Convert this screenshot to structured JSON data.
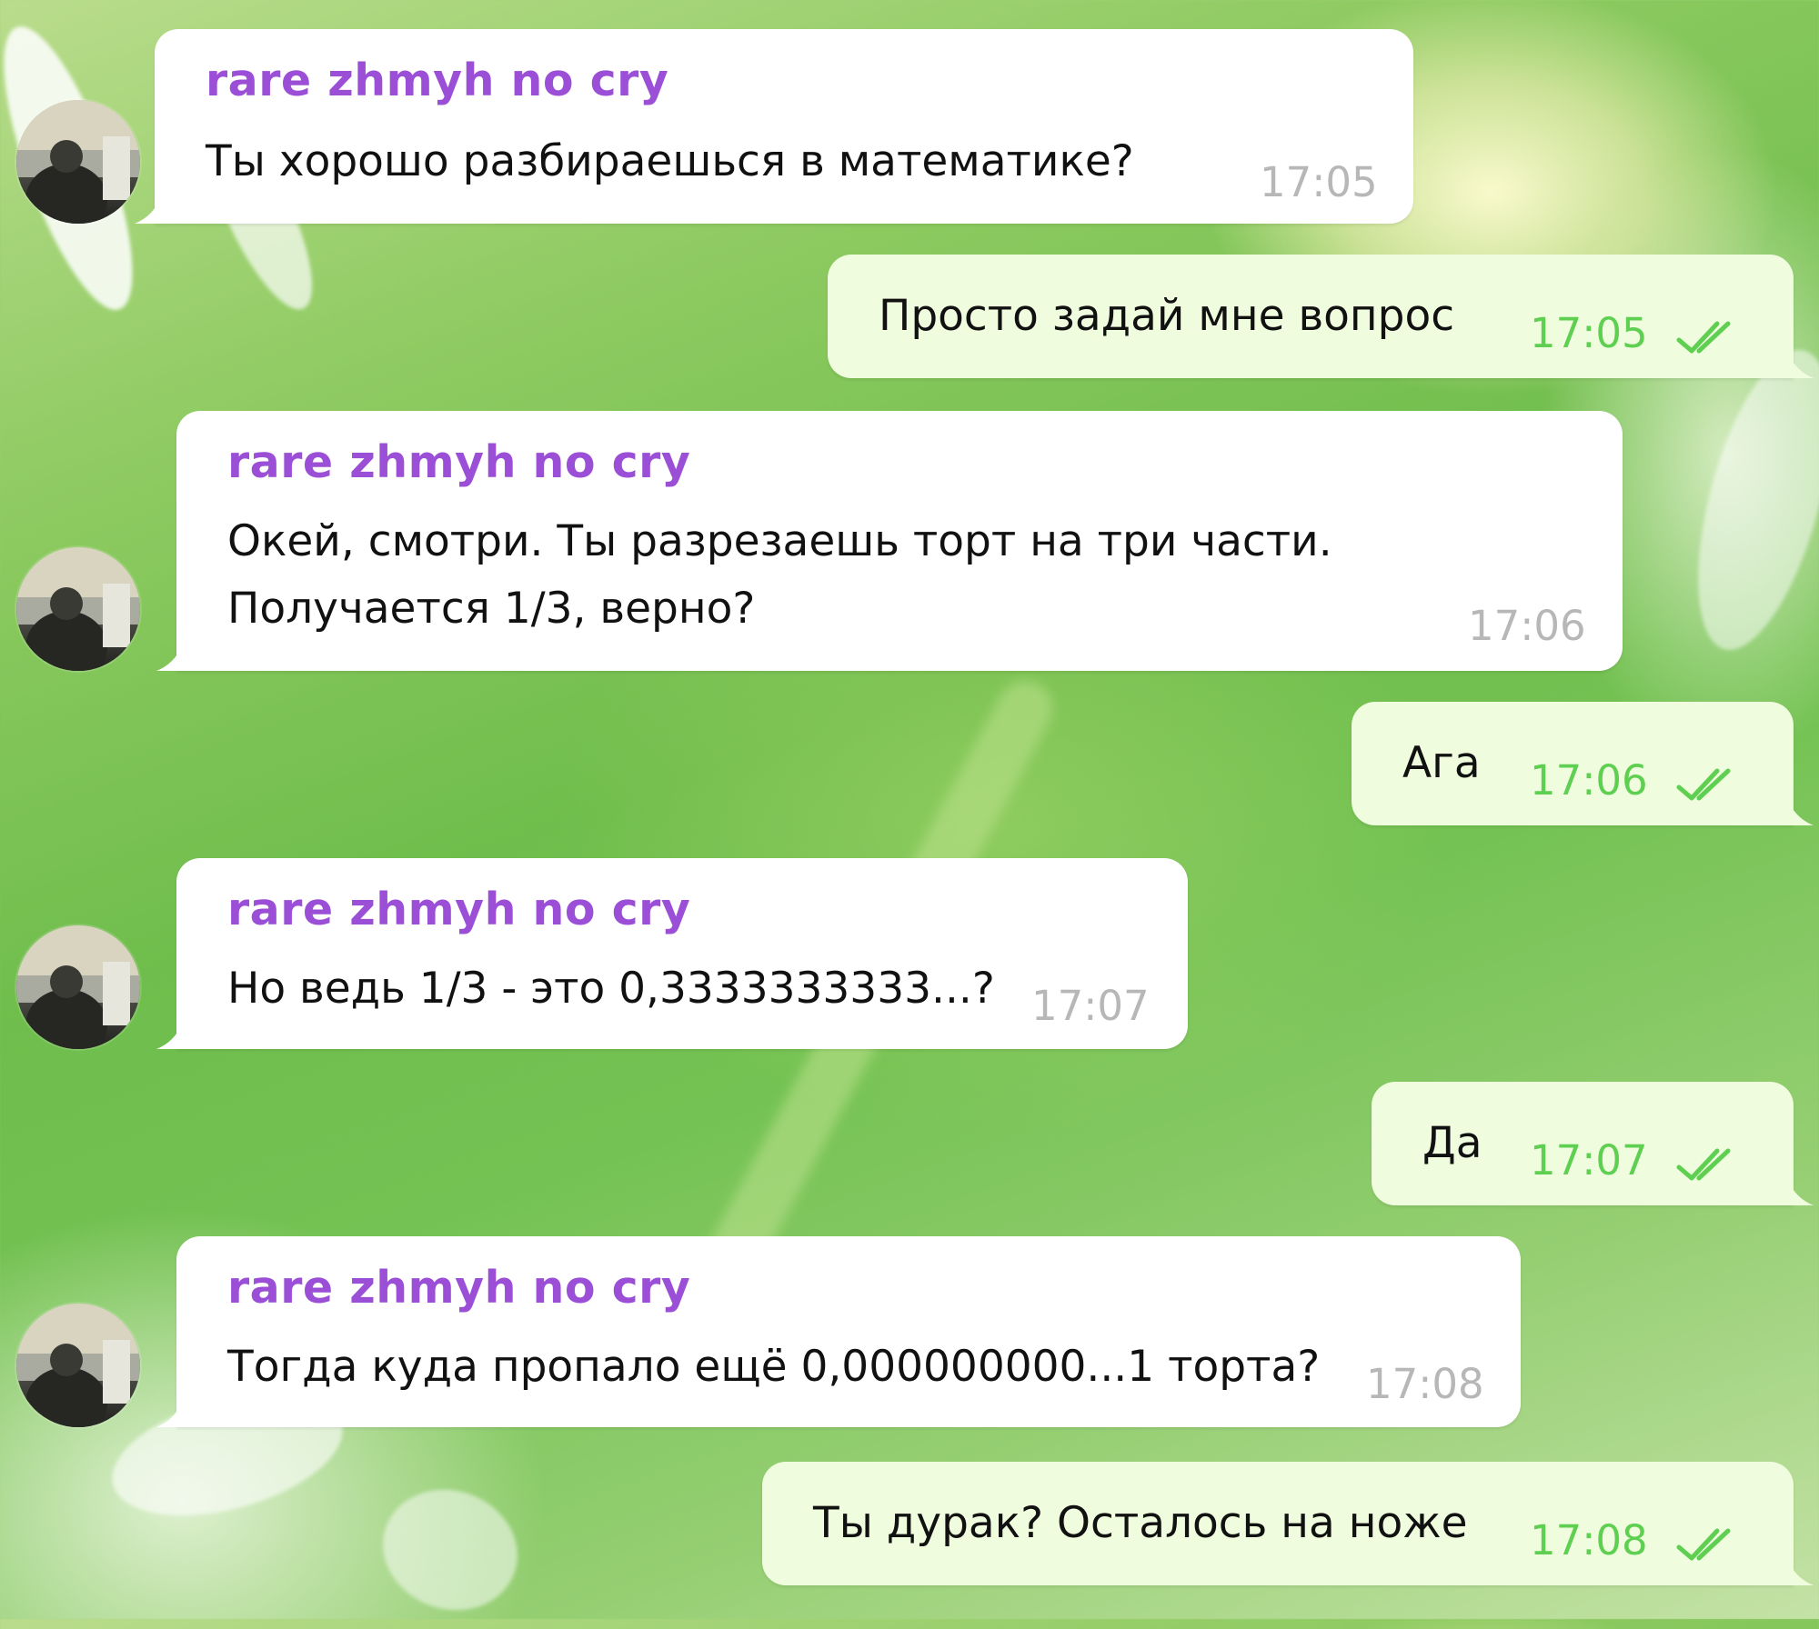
{
  "colors": {
    "sender_name": "#9b4fd6",
    "incoming_bubble": "#ffffff",
    "outgoing_bubble": "#effdde",
    "outgoing_time": "#5fcf52",
    "incoming_time": "#b7b7b7",
    "read_check": "#5fcf52"
  },
  "icons": {
    "read_receipt": "double-check-icon",
    "avatar": "user-avatar"
  },
  "messages": [
    {
      "direction": "incoming",
      "sender": "rare zhmyh no cry",
      "lines": [
        "Ты хорошо разбираешься в математике?"
      ],
      "time": "17:05"
    },
    {
      "direction": "outgoing",
      "lines": [
        "Просто задай мне вопрос"
      ],
      "time": "17:05",
      "status": "read"
    },
    {
      "direction": "incoming",
      "sender": "rare zhmyh no cry",
      "lines": [
        "Окей, смотри. Ты разрезаешь торт на три части.",
        "Получается 1/3, верно?"
      ],
      "time": "17:06"
    },
    {
      "direction": "outgoing",
      "lines": [
        "Ага"
      ],
      "time": "17:06",
      "status": "read"
    },
    {
      "direction": "incoming",
      "sender": "rare zhmyh no cry",
      "lines": [
        "Но ведь 1/3 - это 0,3333333333...?"
      ],
      "time": "17:07"
    },
    {
      "direction": "outgoing",
      "lines": [
        "Да"
      ],
      "time": "17:07",
      "status": "read"
    },
    {
      "direction": "incoming",
      "sender": "rare zhmyh no cry",
      "lines": [
        "Тогда куда пропало ещё 0,000000000...1 торта?"
      ],
      "time": "17:08"
    },
    {
      "direction": "outgoing",
      "lines": [
        "Ты дурак? Осталось на ноже"
      ],
      "time": "17:08",
      "status": "read"
    }
  ]
}
